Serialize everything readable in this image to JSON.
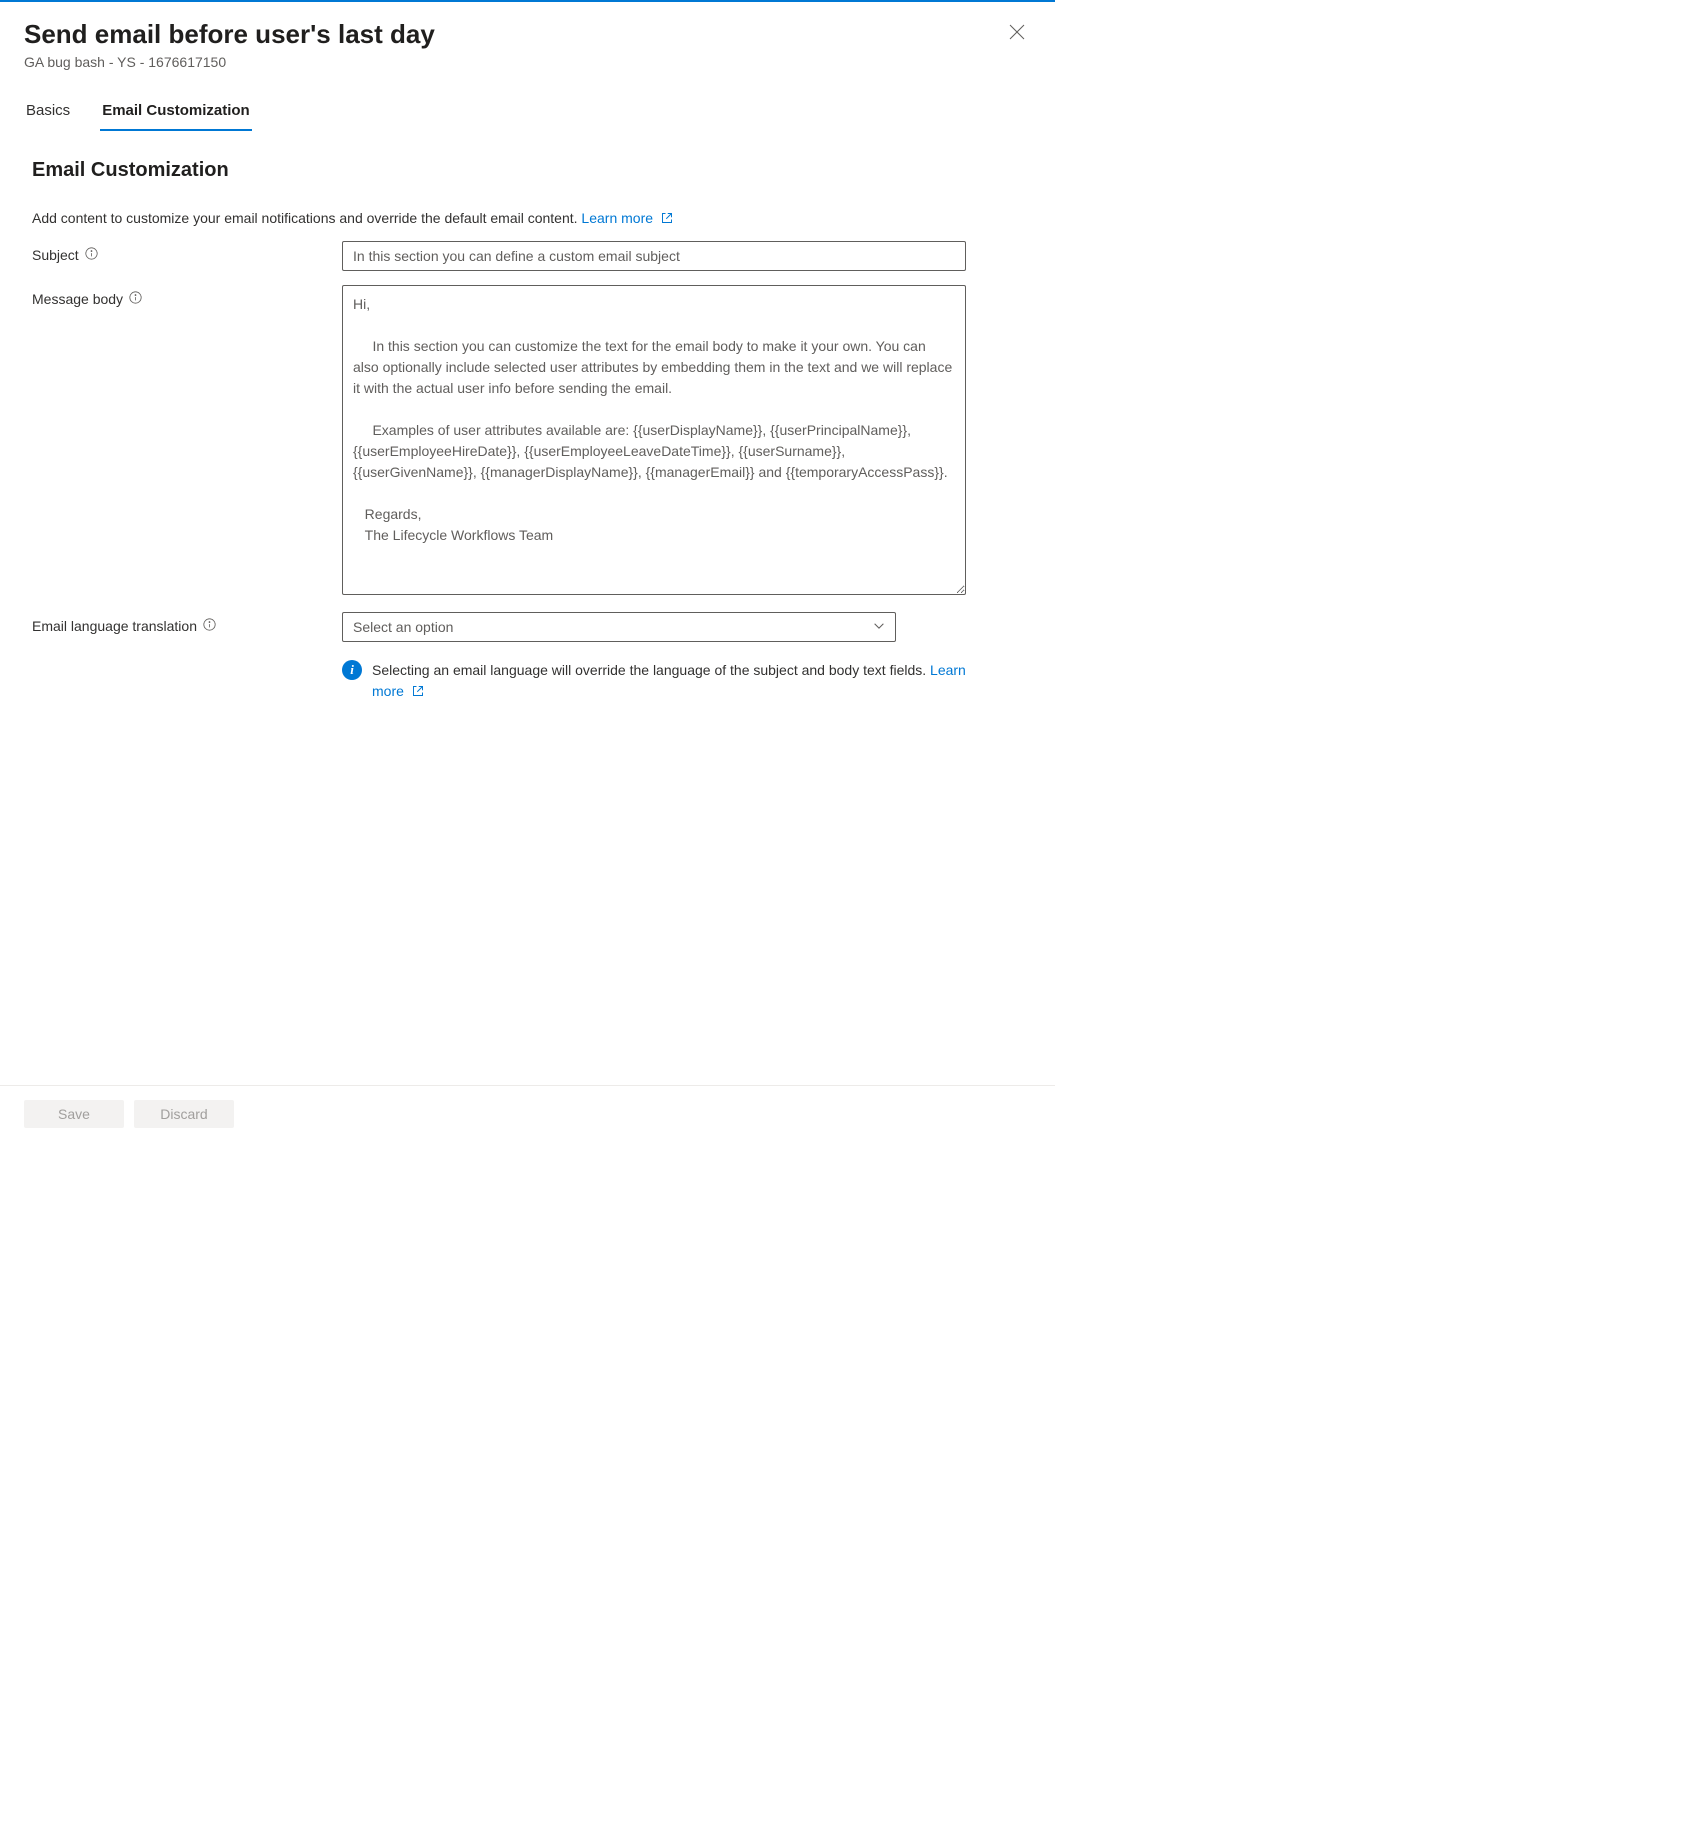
{
  "header": {
    "title": "Send email before user's last day",
    "subtitle": "GA bug bash - YS - 1676617150"
  },
  "tabs": {
    "basics": "Basics",
    "emailCustomization": "Email Customization"
  },
  "section": {
    "title": "Email Customization",
    "description": "Add content to customize your email notifications and override the default email content.",
    "learnMore": "Learn more"
  },
  "form": {
    "subject": {
      "label": "Subject",
      "placeholder": "In this section you can define a custom email subject",
      "value": ""
    },
    "messageBody": {
      "label": "Message body",
      "placeholder": "Hi,\n\n     In this section you can customize the text for the email body to make it your own. You can also optionally include selected user attributes by embedding them in the text and we will replace it with the actual user info before sending the email.\n\n     Examples of user attributes available are: {{userDisplayName}}, {{userPrincipalName}}, {{userEmployeeHireDate}}, {{userEmployeeLeaveDateTime}}, {{userSurname}}, {{userGivenName}}, {{managerDisplayName}}, {{managerEmail}} and {{temporaryAccessPass}}.\n\n   Regards,\n   The Lifecycle Workflows Team",
      "value": ""
    },
    "language": {
      "label": "Email language translation",
      "placeholder": "Select an option",
      "infoText": "Selecting an email language will override the language of the subject and body text fields.",
      "learnMore": "Learn more"
    }
  },
  "footer": {
    "save": "Save",
    "discard": "Discard"
  }
}
